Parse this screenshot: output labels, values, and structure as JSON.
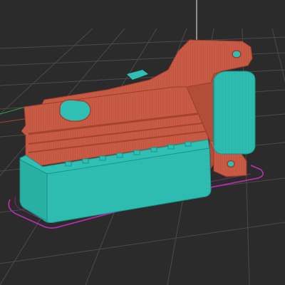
{
  "viewport": {
    "background_color": "#2b2b2b",
    "grid_line_color": "#4a4a4a",
    "axis_x_color": "#b83a3a",
    "axis_y_color": "#2e9e4a",
    "axis_z_color": "#cfcfcf"
  },
  "model": {
    "body_color": "#c95a45",
    "body_shadow_color": "#a5432f",
    "insert_color": "#2fbfb3",
    "insert_shadow_color": "#1d9289",
    "skirt_color": "#b02ea5",
    "hole_color": "#2fbfb3"
  }
}
